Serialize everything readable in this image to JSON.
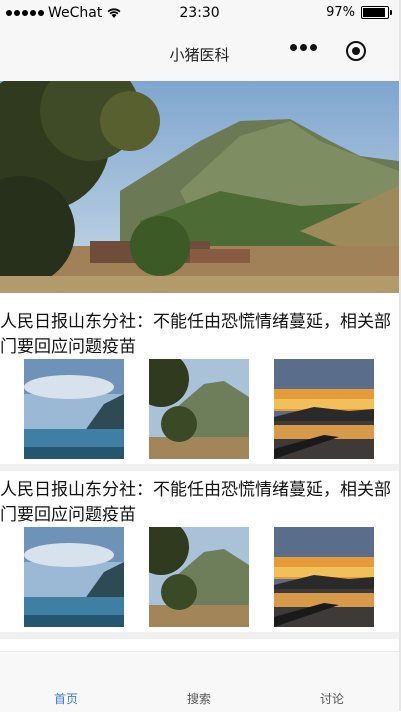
{
  "status_bar": {
    "carrier": "WeChat",
    "time": "23:30",
    "battery_percent": "97%",
    "battery_level": 0.97
  },
  "nav": {
    "title": "小猪医科",
    "more_icon": "more-dots-icon",
    "close_icon": "close-circle-icon"
  },
  "banner": {
    "image": "mountain-landscape"
  },
  "articles": [
    {
      "title": "人民日报山东分社：不能任由恐慌情绪蔓延，相关部门要回应问题疫苗",
      "thumbnails": [
        "lake-clouds",
        "mountain-forest",
        "sunset-lake"
      ]
    },
    {
      "title": "人民日报山东分社：不能任由恐慌情绪蔓延，相关部门要回应问题疫苗",
      "thumbnails": [
        "lake-clouds",
        "mountain-forest",
        "sunset-lake"
      ]
    }
  ],
  "tabs": [
    {
      "label": "首页",
      "active": true
    },
    {
      "label": "搜索",
      "active": false
    },
    {
      "label": "讨论",
      "active": false
    }
  ],
  "colors": {
    "tab_active": "#3a7bd5",
    "tab_inactive": "#555555",
    "bar_background": "#f7f7f7"
  }
}
